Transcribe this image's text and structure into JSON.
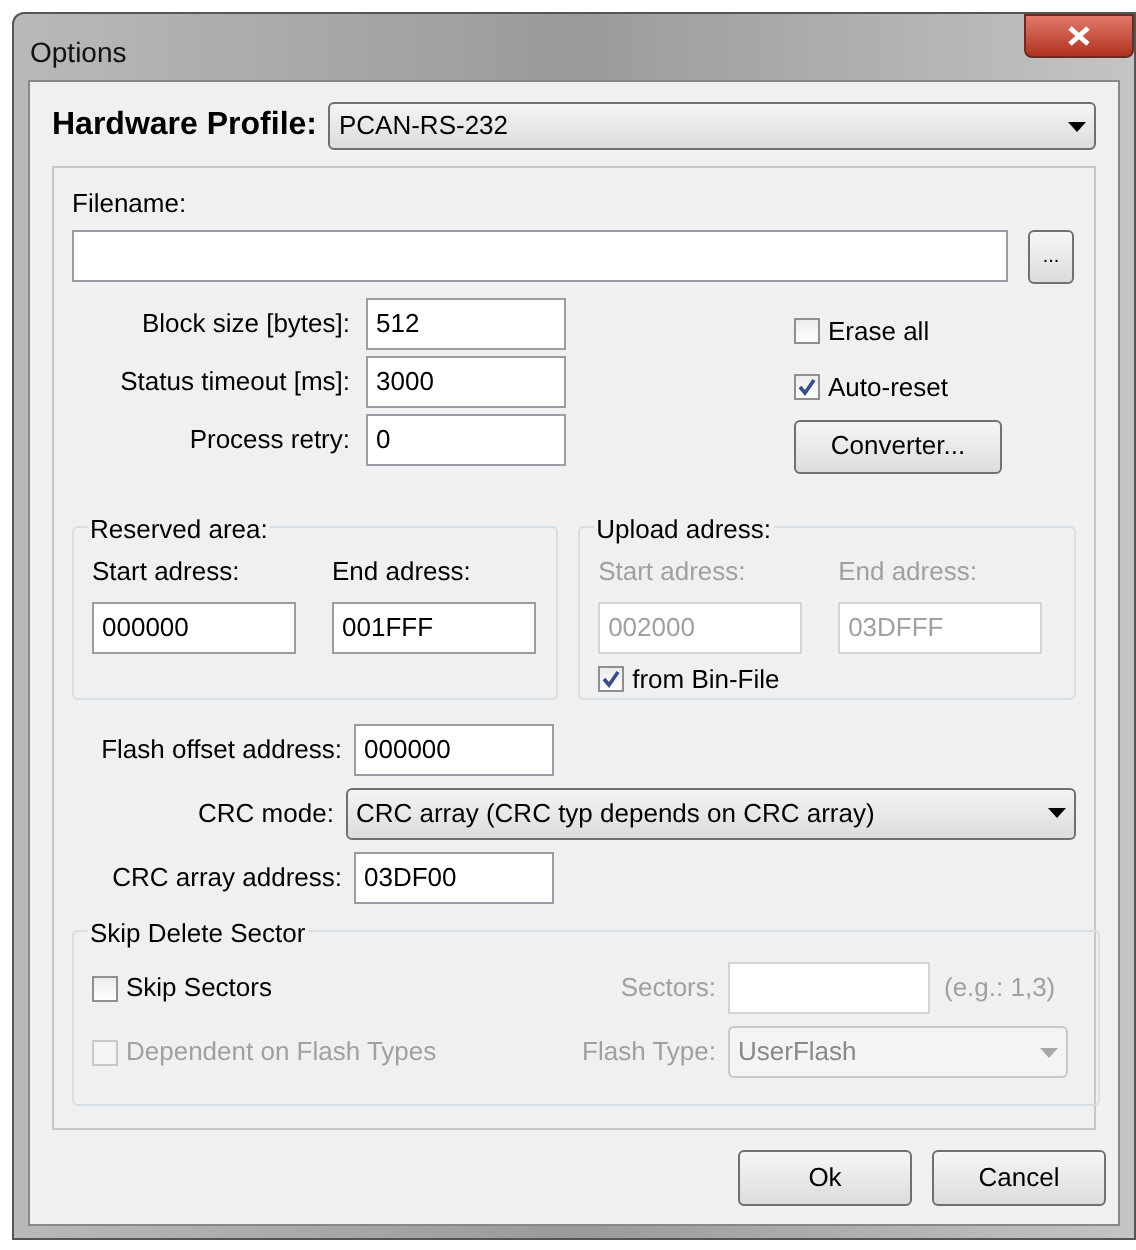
{
  "window": {
    "title": "Options"
  },
  "hardware_profile": {
    "label": "Hardware Profile:",
    "value": "PCAN-RS-232"
  },
  "filename": {
    "label": "Filename:",
    "browse_button": "..."
  },
  "settings": [
    {
      "label": "Block size [bytes]:",
      "value": "512"
    },
    {
      "label": "Status timeout [ms]:",
      "value": "3000"
    },
    {
      "label": "Process retry:",
      "value": "0"
    }
  ],
  "options": [
    {
      "label": "Erase all",
      "checked": false
    },
    {
      "label": "Auto-reset",
      "checked": true
    }
  ],
  "converter_button": "Converter...",
  "reserved_area": {
    "title": "Reserved area:",
    "fields": [
      {
        "label": "Start adress:",
        "value": "000000",
        "disabled": false
      },
      {
        "label": "End adress:",
        "value": "001FFF",
        "disabled": false
      }
    ]
  },
  "upload_adress": {
    "title": "Upload adress:",
    "fields": [
      {
        "label": "Start adress:",
        "value": "002000",
        "disabled": true
      },
      {
        "label": "End adress:",
        "value": "03DFFF",
        "disabled": true
      }
    ],
    "from_bin_file": {
      "label": "from Bin-File",
      "checked": true
    }
  },
  "flash_offset": {
    "label": "Flash offset address:",
    "value": "000000"
  },
  "crc_mode": {
    "label": "CRC mode:",
    "value": "CRC array (CRC typ depends on CRC array)"
  },
  "crc_array_address": {
    "label": "CRC array address:",
    "value": "03DF00"
  },
  "skip_delete_sector": {
    "title": "Skip Delete Sector",
    "skip_sectors": {
      "label": "Skip Sectors",
      "checked": false,
      "disabled": false
    },
    "sectors": {
      "label": "Sectors:",
      "hint": "(e.g.: 1,3)",
      "disabled": true
    },
    "dependent": {
      "label": "Dependent on Flash Types",
      "checked": false,
      "disabled": true
    },
    "flash_type": {
      "label": "Flash Type:",
      "value": "UserFlash",
      "disabled": true
    }
  },
  "buttons": [
    "Ok",
    "Cancel"
  ]
}
